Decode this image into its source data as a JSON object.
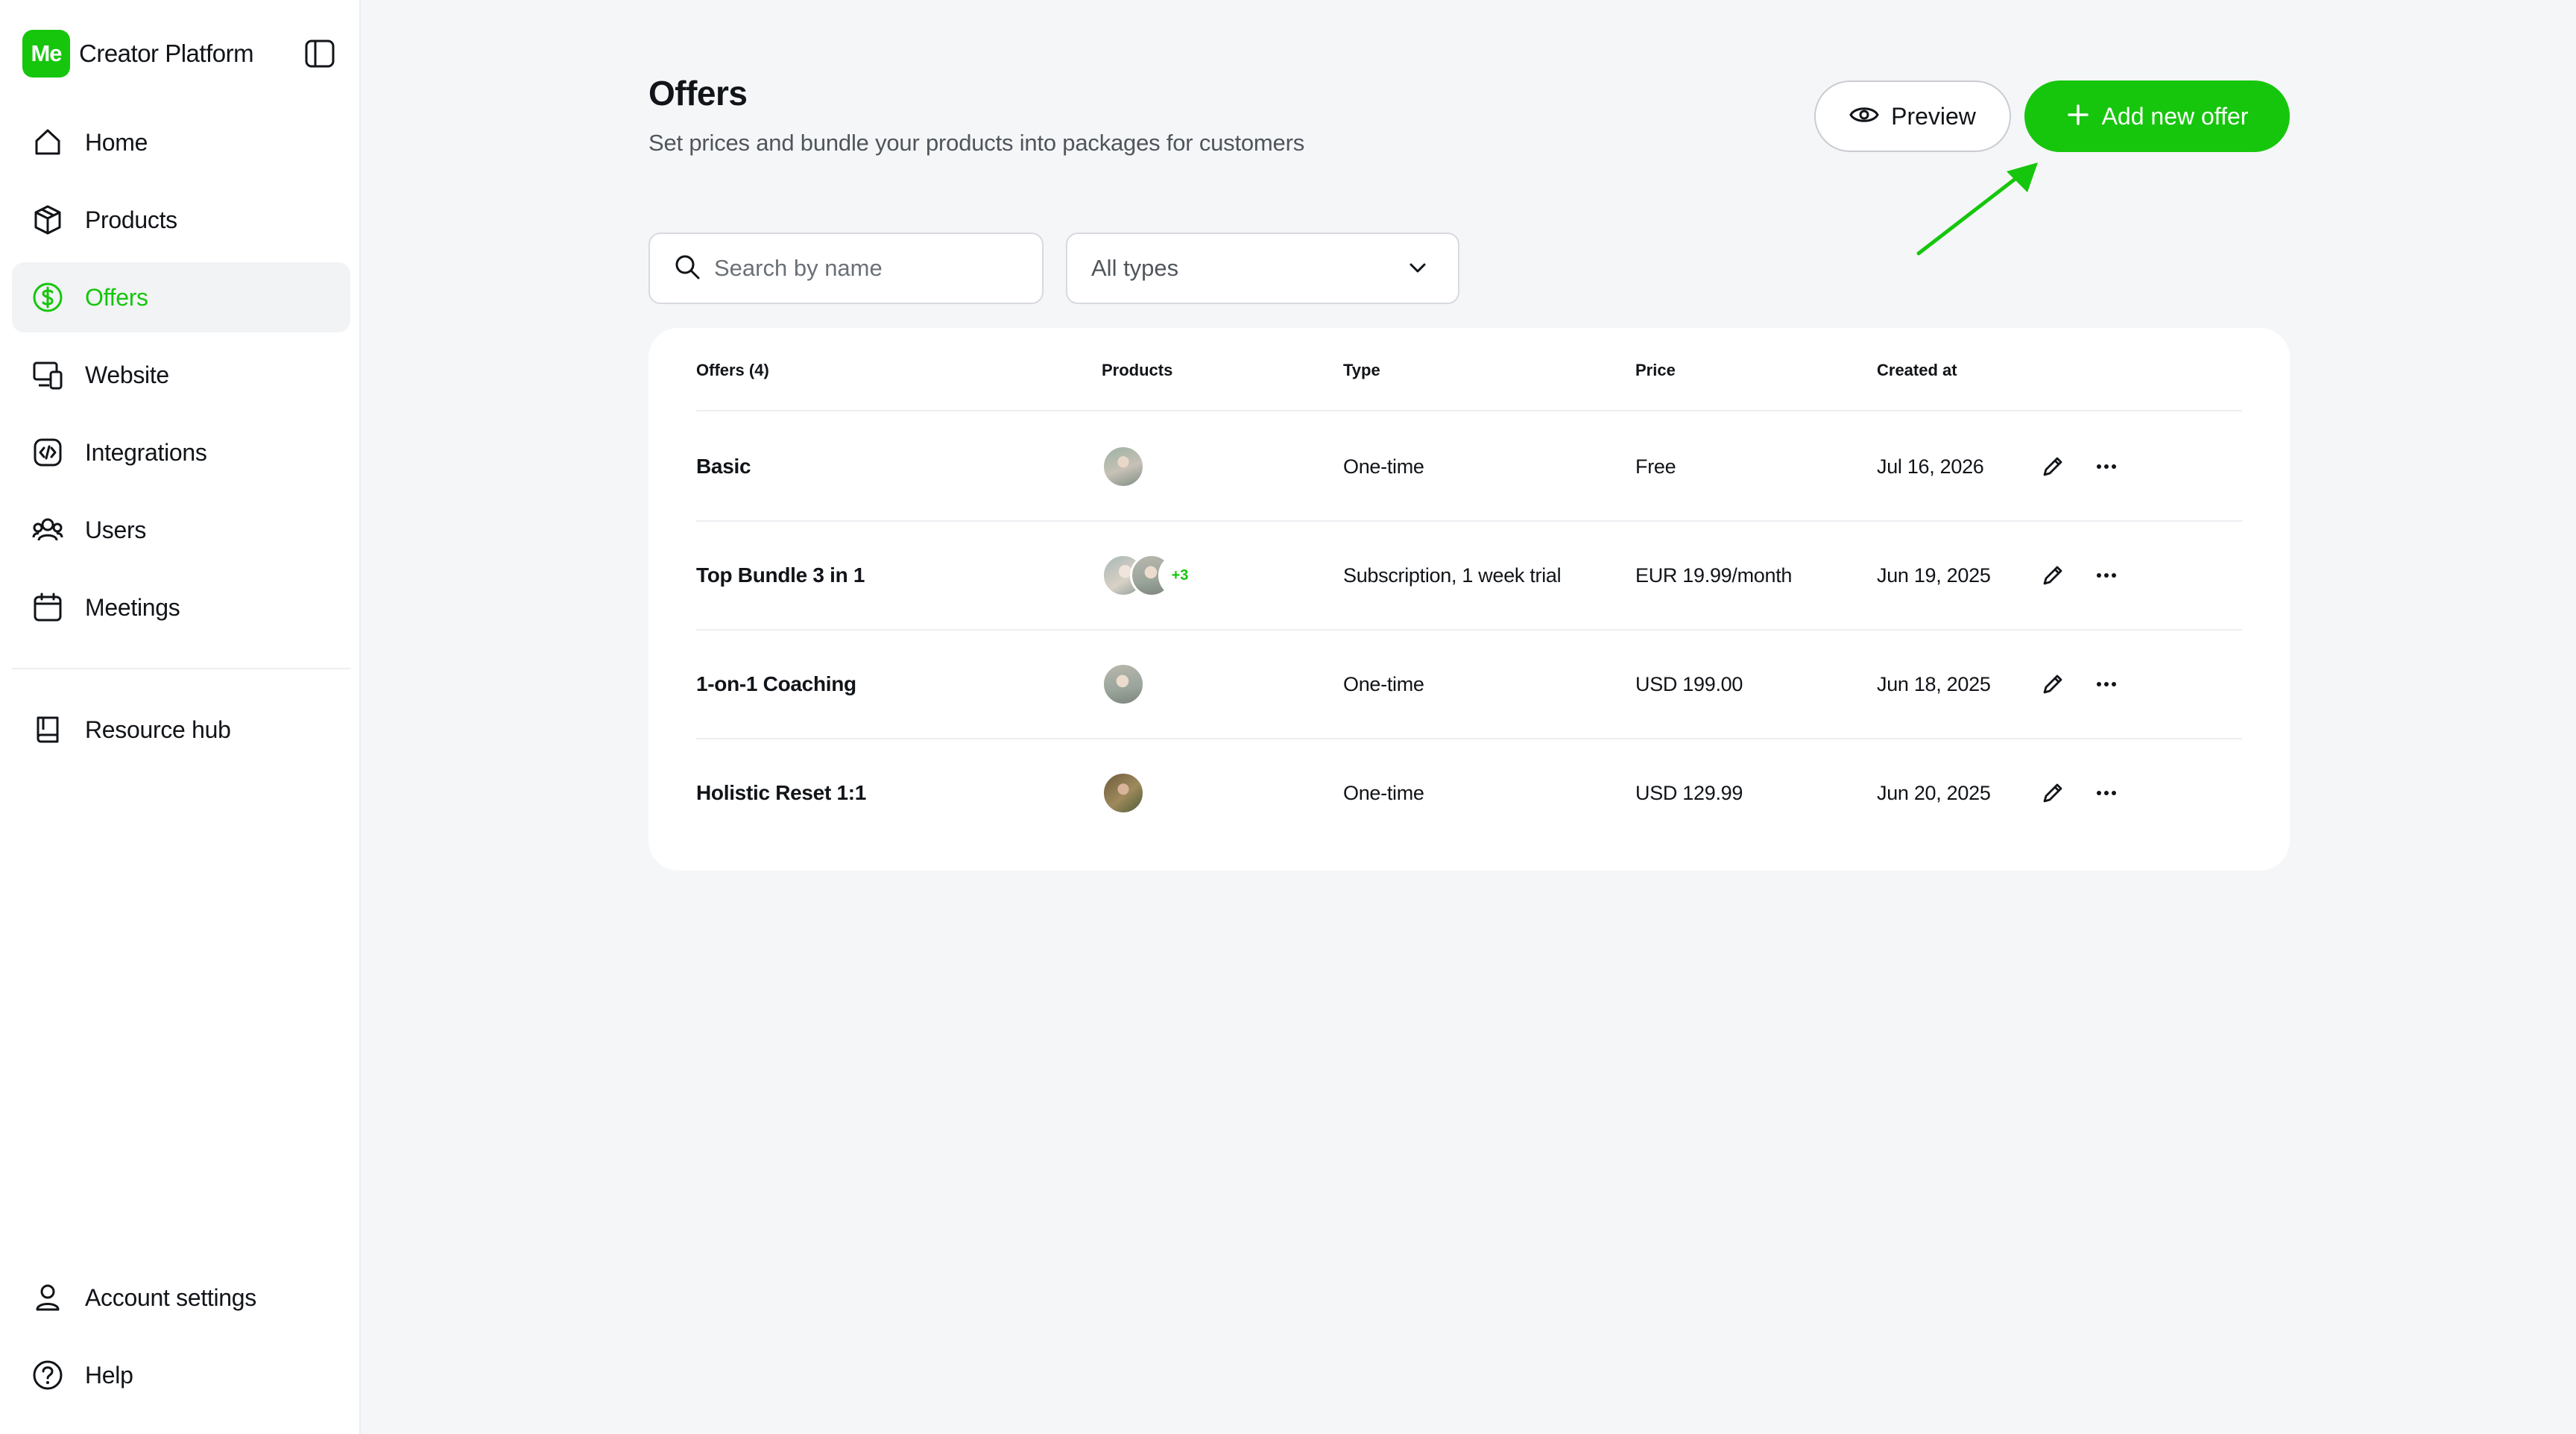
{
  "brand": {
    "logo_text": "Me",
    "name": "Creator Platform"
  },
  "nav": {
    "items": [
      {
        "label": "Home",
        "icon": "home-icon"
      },
      {
        "label": "Products",
        "icon": "box-icon"
      },
      {
        "label": "Offers",
        "icon": "dollar-circle-icon",
        "active": true
      },
      {
        "label": "Website",
        "icon": "devices-icon"
      },
      {
        "label": "Integrations",
        "icon": "code-square-icon"
      },
      {
        "label": "Users",
        "icon": "users-icon"
      },
      {
        "label": "Meetings",
        "icon": "calendar-icon"
      }
    ],
    "resource": {
      "label": "Resource hub",
      "icon": "book-icon"
    },
    "bottom": [
      {
        "label": "Account settings",
        "icon": "user-icon"
      },
      {
        "label": "Help",
        "icon": "help-circle-icon"
      }
    ]
  },
  "page": {
    "title": "Offers",
    "subtitle": "Set prices and bundle your products into packages for customers"
  },
  "actions": {
    "preview_label": "Preview",
    "add_label": "Add new offer"
  },
  "filters": {
    "search_placeholder": "Search by name",
    "type_selected": "All types"
  },
  "table": {
    "columns": [
      "Offers (4)",
      "Products",
      "Type",
      "Price",
      "Created at"
    ],
    "rows": [
      {
        "name": "Basic",
        "products_extra": "",
        "type": "One-time",
        "price": "Free",
        "created": "Jul 16, 2026"
      },
      {
        "name": "Top Bundle 3 in 1",
        "products_extra": "+3",
        "type": "Subscription, 1 week trial",
        "price": "EUR 19.99/month",
        "created": "Jun 19, 2025"
      },
      {
        "name": "1-on-1 Coaching",
        "products_extra": "",
        "type": "One-time",
        "price": "USD 199.00",
        "created": "Jun 18, 2025"
      },
      {
        "name": "Holistic Reset 1:1",
        "products_extra": "",
        "type": "One-time",
        "price": "USD 129.99",
        "created": "Jun 20, 2025"
      }
    ]
  },
  "colors": {
    "accent": "#16c60c",
    "background": "#f5f6f8",
    "card": "#ffffff",
    "text": "#111418",
    "muted": "#50555c"
  }
}
